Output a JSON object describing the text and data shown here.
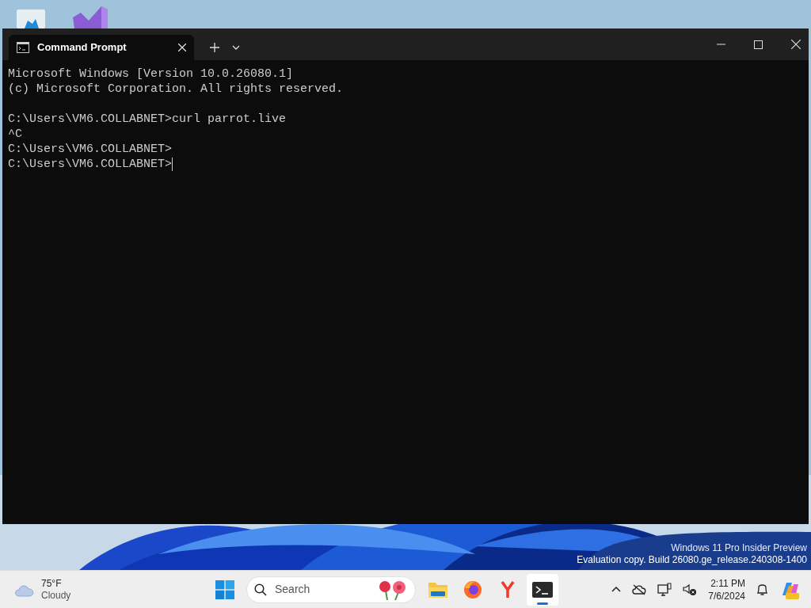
{
  "window": {
    "tab_title": "Command Prompt"
  },
  "terminal": {
    "lines": [
      {
        "kind": "text",
        "text": "Microsoft Windows [Version 10.0.26080.1]"
      },
      {
        "kind": "text",
        "text": "(c) Microsoft Corporation. All rights reserved."
      },
      {
        "kind": "blank"
      },
      {
        "kind": "text",
        "text": "C:\\Users\\VM6.COLLABNET>curl parrot.live"
      },
      {
        "kind": "text",
        "text": "^C"
      },
      {
        "kind": "text",
        "text": "C:\\Users\\VM6.COLLABNET>"
      },
      {
        "kind": "prompt",
        "text": "C:\\Users\\VM6.COLLABNET>"
      }
    ]
  },
  "watermark": [
    "Windows 11 Pro Insider Preview",
    "Evaluation copy. Build 26080.ge_release.240308-1400"
  ],
  "taskbar": {
    "weather": {
      "temperature": "75°F",
      "condition": "Cloudy"
    },
    "search": {
      "placeholder": "Search"
    },
    "apps": [
      {
        "kind": "files",
        "selected": false
      },
      {
        "kind": "firefox",
        "selected": false
      },
      {
        "kind": "yandex",
        "selected": false
      },
      {
        "kind": "terminal",
        "selected": true
      }
    ],
    "clock": {
      "time": "2:11 PM",
      "date": "7/6/2024"
    }
  }
}
